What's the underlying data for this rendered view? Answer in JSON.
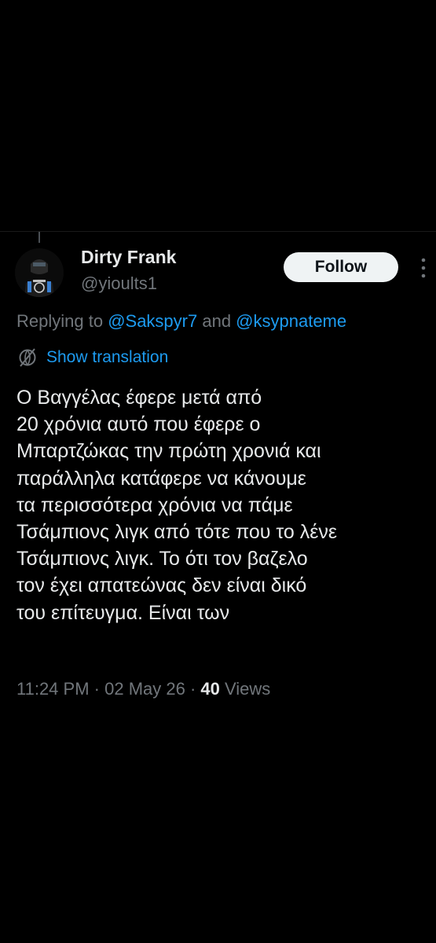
{
  "tweet": {
    "author": {
      "display_name": "Dirty Frank",
      "handle": "@yioults1"
    },
    "follow_label": "Follow",
    "reply_context": {
      "prefix": "Replying to ",
      "mention_1": "@Sakspyr7",
      "joiner": " and ",
      "mention_2": "@ksypnateme"
    },
    "show_translation_label": "Show translation",
    "text_lines": [
      "Ο Βαγγέλας έφερε μετά από",
      "20 χρόνια αυτό που έφερε ο",
      "Μπαρτζώκας την πρώτη χρονιά και",
      "παράλληλα κατάφερε να κάνουμε",
      "τα περισσότερα χρόνια να πάμε",
      "Τσάμπιονς λιγκ από τότε που το λένε",
      "Τσάμπιονς λιγκ. Το ότι τον βαζελο",
      "τον έχει απατεώνας δεν είναι δικό",
      "του επίτευγμα. Είναι των"
    ],
    "meta": {
      "time": "11:24 PM",
      "separator": " · ",
      "date": "02 May 26",
      "views_count": "40",
      "views_label": " Views"
    }
  },
  "icons": {
    "more": "more-vertical-icon",
    "translation": "translate-globe-icon"
  },
  "colors": {
    "background": "#000000",
    "text_primary": "#e7e9ea",
    "text_secondary": "#71767b",
    "link": "#1d9bf0",
    "follow_bg": "#eff3f4"
  }
}
